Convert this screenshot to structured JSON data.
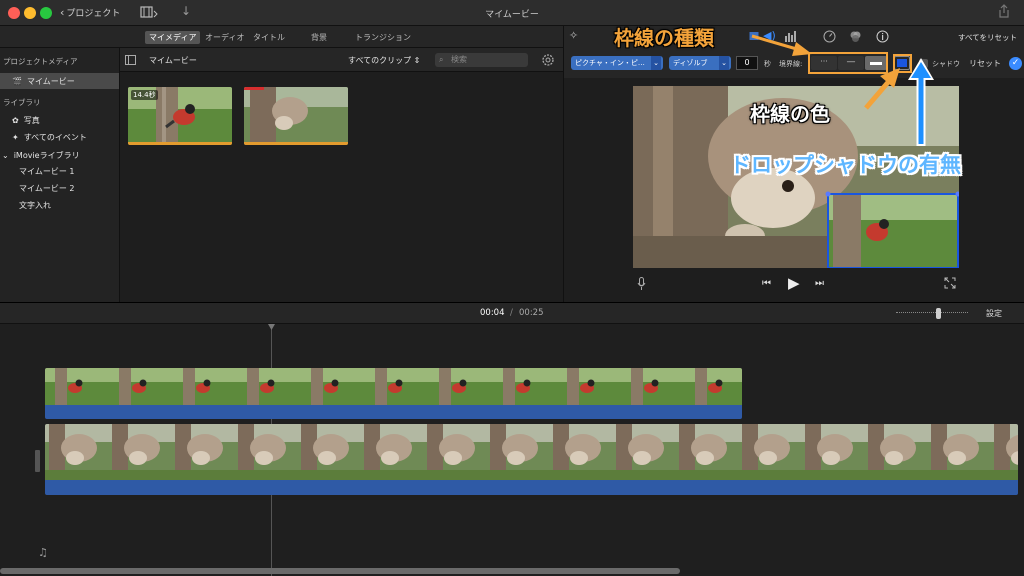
{
  "window": {
    "title": "マイムービー",
    "back_label": "プロジェクト"
  },
  "browser_tabs": [
    "マイメディア",
    "オーディオ",
    "タイトル",
    "背景",
    "トランジション"
  ],
  "sidebar": {
    "section1": "プロジェクトメディア",
    "project_item": "マイムービー",
    "section2": "ライブラリ",
    "photos": "写真",
    "all_events": "すべてのイベント",
    "library": "iMovieライブラリ",
    "sub_items": [
      "マイムービー 1",
      "マイムービー 2",
      "文字入れ"
    ]
  },
  "media": {
    "header_title": "マイムービー",
    "filter_label": "すべてのクリップ",
    "search_placeholder": "検索",
    "clips": [
      {
        "duration": "14.4秒"
      },
      {
        "duration": ""
      }
    ]
  },
  "viewer": {
    "reset_all": "すべてをリセット",
    "overlay_mode": "ピクチャ・イン・ピ…",
    "transition": "ディゾルブ",
    "duration_value": "0",
    "seconds_unit": "秒",
    "border_label": "境界線:",
    "shadow_label": "シャドウ",
    "reset_label": "リセット",
    "border_color": "#1a56e0"
  },
  "timeline": {
    "current_time": "00:04",
    "separator": "/",
    "total_time": "00:25",
    "settings_label": "設定",
    "zoom_level": 0.6
  },
  "annotations": {
    "border_type": "枠線の種類",
    "border_color": "枠線の色",
    "drop_shadow": "ドロップシャドウの有無"
  },
  "colors": {
    "accent_blue": "#3a6fc0",
    "annotation_orange": "#f3a33a",
    "annotation_blue": "#1e90ff"
  }
}
